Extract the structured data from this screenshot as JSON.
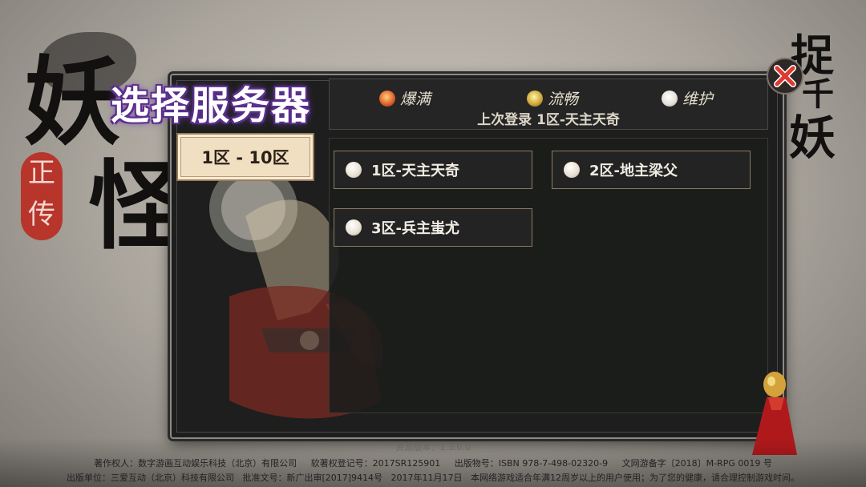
{
  "title": "选择服务器",
  "brand": {
    "left_glyphs": [
      "妖",
      "怪"
    ],
    "seal_glyphs": [
      "正",
      "传"
    ],
    "right_glyphs": [
      "捉",
      "千",
      "妖"
    ]
  },
  "legend": [
    {
      "label": "爆满",
      "color": "#d0532a",
      "icon": "flame-icon"
    },
    {
      "label": "流畅",
      "color": "#c8a12d",
      "icon": "swirl-icon"
    },
    {
      "label": "维护",
      "color": "#e8e4df",
      "icon": "circle-icon"
    }
  ],
  "last_login": "上次登录 1区-天主天奇",
  "tab": {
    "label": "1区 - 10区"
  },
  "servers": [
    {
      "name": "1区-天主天奇"
    },
    {
      "name": "2区-地主梁父"
    },
    {
      "name": "3区-兵主蚩尤"
    }
  ],
  "footer": {
    "version_label": "资源版本：",
    "version_value": "1.3.0.0",
    "line1": [
      "著作权人：数字游画互动娱乐科技（北京）有限公司",
      "软著权登记号：2017SR125901",
      "出版物号：ISBN 978-7-498-02320-9",
      "文网游备字〔2018〕M-RPG 0019 号"
    ],
    "line2": [
      "出版单位：三爱互动（北京）科技有限公司",
      "批准文号：新广出审[2017]9414号",
      "2017年11月17日",
      "本网络游戏适合年满12周岁以上的用户使用；为了您的健康，请合理控制游戏时间。"
    ]
  },
  "colors": {
    "panel_bg": "#1d1e1d",
    "tab_bg": "#f1dfc2",
    "title_glow": "#5b2f8e",
    "close_x": "#e03a30"
  }
}
